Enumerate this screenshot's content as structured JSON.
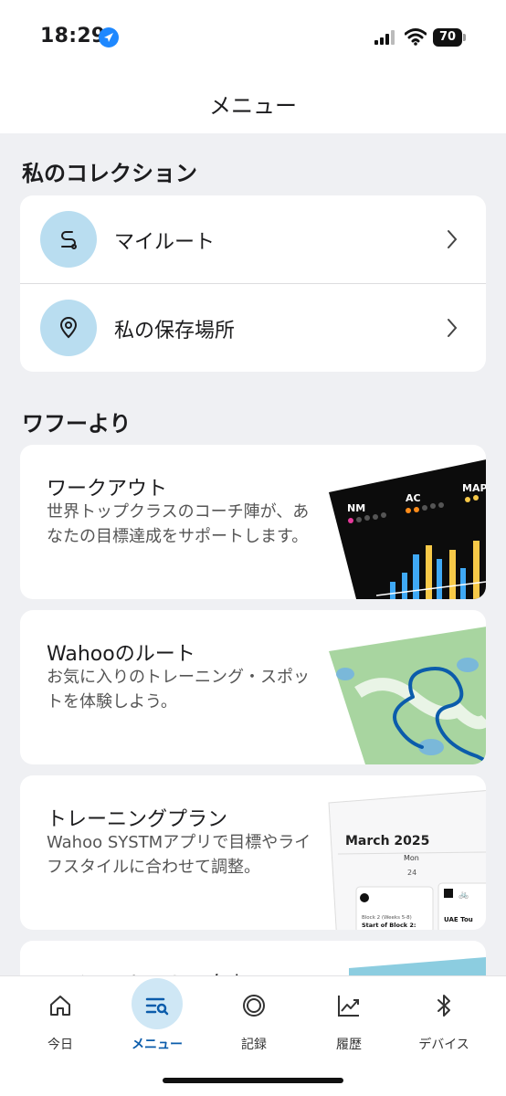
{
  "status_bar": {
    "time": "18:29",
    "battery": "70"
  },
  "header": {
    "title": "メニュー"
  },
  "collection": {
    "title": "私のコレクション",
    "items": [
      {
        "label": "マイルート",
        "icon": "route-icon"
      },
      {
        "label": "私の保存場所",
        "icon": "location-pin-icon"
      }
    ]
  },
  "from_wahoo": {
    "title": "ワフーより",
    "cards": [
      {
        "title": "ワークアウト",
        "description": "世界トップクラスのコーチ陣が、あなたの目標達成をサポートします。",
        "image_labels": [
          "NM",
          "AC",
          "MAP"
        ]
      },
      {
        "title": "Wahooのルート",
        "description": "お気に入りのトレーニング・スポットを体験しよう。"
      },
      {
        "title": "トレーニングプラン",
        "description": "Wahoo SYSTMアプリで目標やライフスタイルに合わせて調整。",
        "calendar": {
          "month": "March 2025",
          "day": "Mon",
          "date": "24",
          "block": "Block 2 (Weeks 5-8)",
          "event": "Start of Block 2:",
          "event2": "UAE Tou"
        }
      },
      {
        "title": "マインドセットの向上"
      }
    ]
  },
  "tabbar": {
    "tabs": [
      {
        "label": "今日",
        "icon": "home-icon",
        "active": false
      },
      {
        "label": "メニュー",
        "icon": "menu-search-icon",
        "active": true
      },
      {
        "label": "記録",
        "icon": "record-icon",
        "active": false
      },
      {
        "label": "履歴",
        "icon": "history-chart-icon",
        "active": false
      },
      {
        "label": "デバイス",
        "icon": "bluetooth-icon",
        "active": false
      }
    ]
  },
  "colors": {
    "accent": "#0b5cab",
    "icon_bg": "#b9ddf0",
    "page_bg": "#eff0f3"
  }
}
